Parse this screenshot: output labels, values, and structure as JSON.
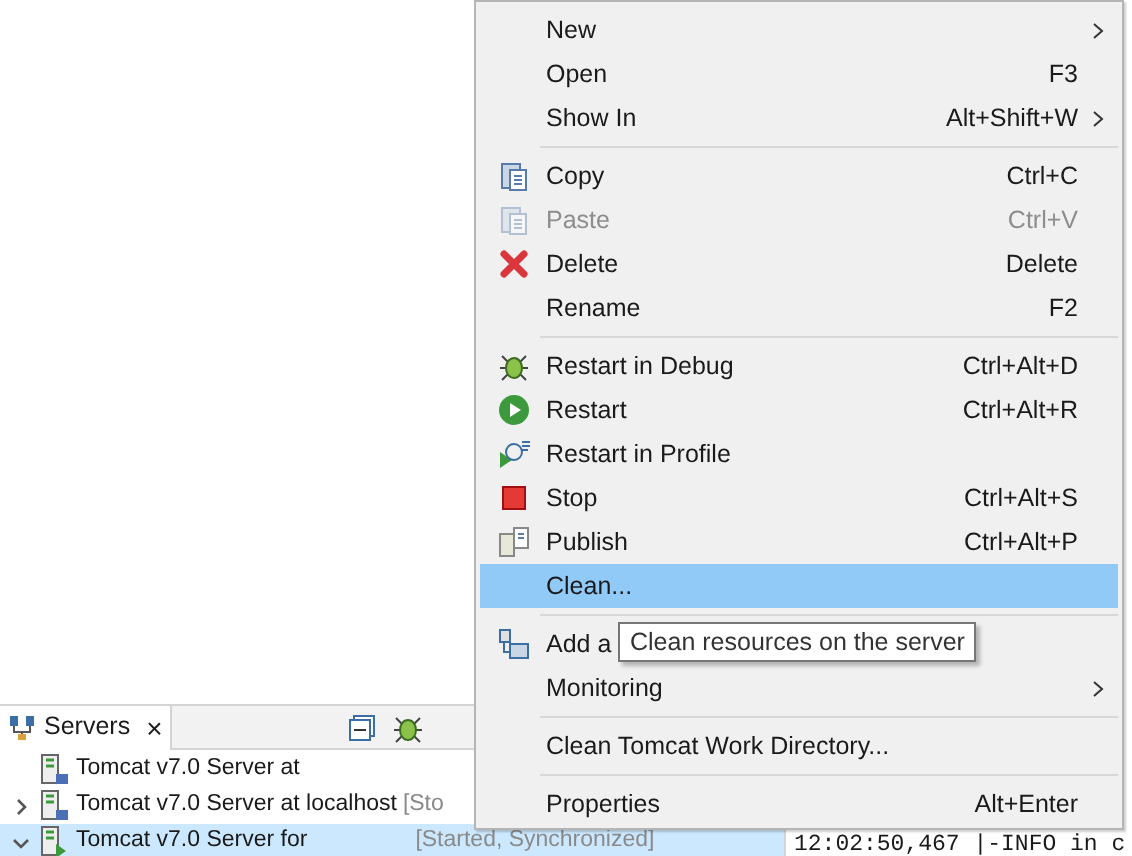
{
  "servers_view": {
    "tab": {
      "label": "Servers",
      "close": "×",
      "selected": true
    },
    "rows": [
      {
        "name": "Tomcat v7.0 Server at",
        "selected": false
      },
      {
        "name": "Tomcat v7.0 Server at localhost",
        "status": "[Sto",
        "expanded": false,
        "selected": false
      },
      {
        "name": "Tomcat v7.0 Server for",
        "status": "[Started, Synchronized]",
        "expanded": true,
        "selected": true
      }
    ]
  },
  "console": {
    "line": "12:02:50,467 |-INFO in c"
  },
  "context_menu": {
    "items": [
      {
        "kind": "item",
        "label": "New",
        "submenu": true,
        "disabled": false,
        "selected": false
      },
      {
        "kind": "item",
        "label": "Open",
        "shortcut": "F3",
        "disabled": false,
        "selected": false
      },
      {
        "kind": "item",
        "label": "Show In",
        "shortcut": "Alt+Shift+W",
        "submenu": true,
        "disabled": false,
        "selected": false
      },
      {
        "kind": "separator"
      },
      {
        "kind": "item",
        "label": "Copy",
        "shortcut": "Ctrl+C",
        "disabled": false,
        "selected": false
      },
      {
        "kind": "item",
        "label": "Paste",
        "shortcut": "Ctrl+V",
        "disabled": true,
        "selected": false
      },
      {
        "kind": "item",
        "label": "Delete",
        "shortcut": "Delete",
        "disabled": false,
        "selected": false
      },
      {
        "kind": "item",
        "label": "Rename",
        "shortcut": "F2",
        "disabled": false,
        "selected": false
      },
      {
        "kind": "separator"
      },
      {
        "kind": "item",
        "label": "Restart in Debug",
        "shortcut": "Ctrl+Alt+D",
        "disabled": false,
        "selected": false
      },
      {
        "kind": "item",
        "label": "Restart",
        "shortcut": "Ctrl+Alt+R",
        "disabled": false,
        "selected": false
      },
      {
        "kind": "item",
        "label": "Restart in Profile",
        "disabled": false,
        "selected": false
      },
      {
        "kind": "item",
        "label": "Stop",
        "shortcut": "Ctrl+Alt+S",
        "disabled": false,
        "selected": false
      },
      {
        "kind": "item",
        "label": "Publish",
        "shortcut": "Ctrl+Alt+P",
        "disabled": false,
        "selected": false
      },
      {
        "kind": "item",
        "label": "Clean...",
        "disabled": false,
        "selected": true
      },
      {
        "kind": "separator"
      },
      {
        "kind": "item",
        "label": "Add a",
        "disabled": false,
        "selected": false
      },
      {
        "kind": "item",
        "label": "Monitoring",
        "submenu": true,
        "disabled": false,
        "selected": false
      },
      {
        "kind": "separator"
      },
      {
        "kind": "item",
        "label": "Clean Tomcat Work Directory...",
        "disabled": false,
        "selected": false
      },
      {
        "kind": "separator"
      },
      {
        "kind": "item",
        "label": "Properties",
        "shortcut": "Alt+Enter",
        "disabled": false,
        "selected": false
      }
    ]
  },
  "tooltip": {
    "text": "Clean resources on the server"
  }
}
